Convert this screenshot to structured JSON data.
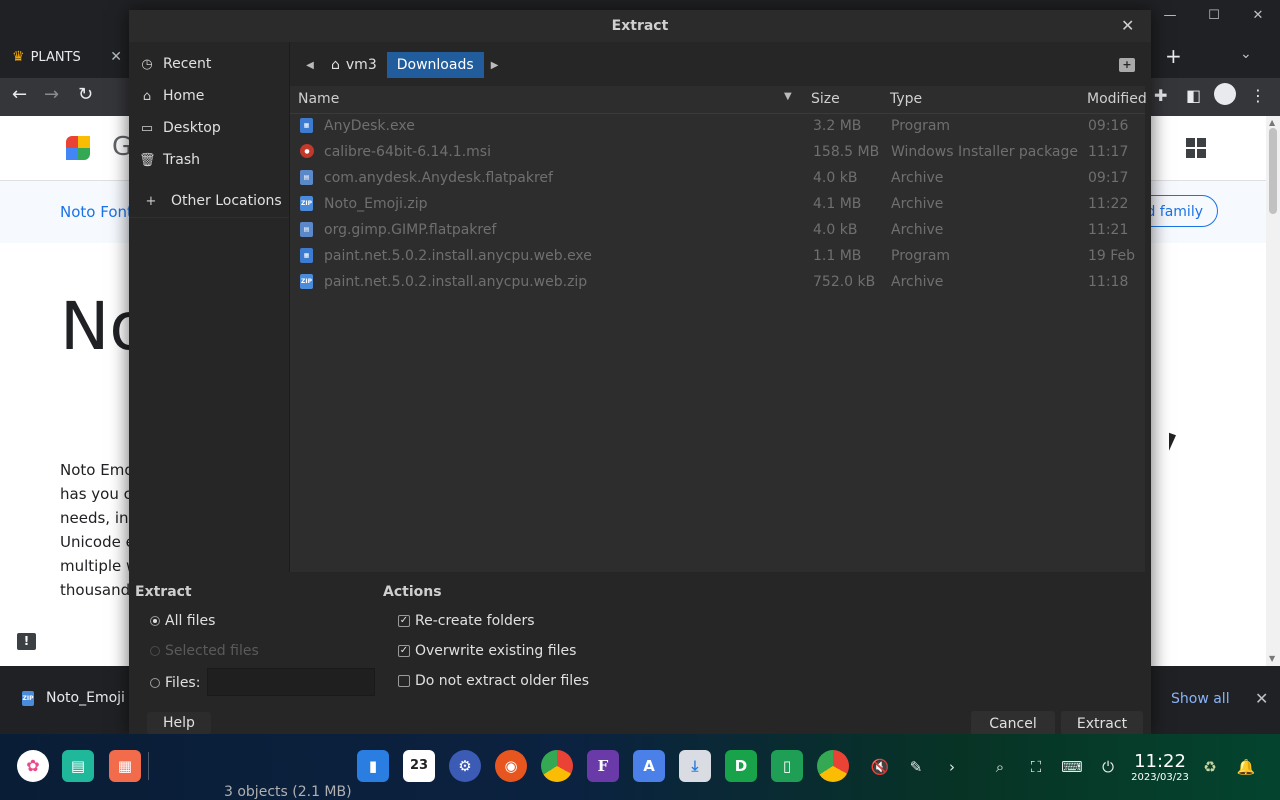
{
  "browser": {
    "tab_label": "PLANTS",
    "subnav_link": "Noto Font",
    "family_button": "d family",
    "big_title": "No",
    "body_lines": [
      "Noto Emo",
      "has you c",
      "needs, inc",
      "Unicode e",
      "multiple w",
      "thousand"
    ],
    "download_item": "Noto_Emoji",
    "show_all": "Show all"
  },
  "dialog": {
    "title": "Extract",
    "places": [
      "Recent",
      "Home",
      "Desktop",
      "Trash",
      "Other Locations"
    ],
    "path": [
      "vm3",
      "Downloads"
    ],
    "columns": {
      "name": "Name",
      "size": "Size",
      "type": "Type",
      "modified": "Modified"
    },
    "files": [
      {
        "name": "AnyDesk.exe",
        "size": "3.2 MB",
        "type": "Program",
        "modified": "09:16",
        "icon": "exe"
      },
      {
        "name": "calibre-64bit-6.14.1.msi",
        "size": "158.5 MB",
        "type": "Windows Installer package",
        "modified": "11:17",
        "icon": "msi"
      },
      {
        "name": "com.anydesk.Anydesk.flatpakref",
        "size": "4.0 kB",
        "type": "Archive",
        "modified": "09:17",
        "icon": "pak"
      },
      {
        "name": "Noto_Emoji.zip",
        "size": "4.1 MB",
        "type": "Archive",
        "modified": "11:22",
        "icon": "zip"
      },
      {
        "name": "org.gimp.GIMP.flatpakref",
        "size": "4.0 kB",
        "type": "Archive",
        "modified": "11:21",
        "icon": "pak"
      },
      {
        "name": "paint.net.5.0.2.install.anycpu.web.exe",
        "size": "1.1 MB",
        "type": "Program",
        "modified": "19 Feb",
        "icon": "exe"
      },
      {
        "name": "paint.net.5.0.2.install.anycpu.web.zip",
        "size": "752.0 kB",
        "type": "Archive",
        "modified": "11:18",
        "icon": "zip"
      }
    ],
    "extract_group": {
      "title": "Extract",
      "all_files": "All files",
      "selected_files": "Selected files",
      "files_label": "Files:",
      "files_value": ""
    },
    "actions_group": {
      "title": "Actions",
      "recreate_folders": "Re-create folders",
      "overwrite": "Overwrite existing files",
      "no_older": "Do not extract older files"
    },
    "buttons": {
      "help": "Help",
      "cancel": "Cancel",
      "extract": "Extract"
    }
  },
  "taskbar": {
    "calendar_day": "23",
    "clock_time": "11:22",
    "clock_date": "2023/03/23",
    "status_text": "3 objects (2.1 MB)"
  }
}
